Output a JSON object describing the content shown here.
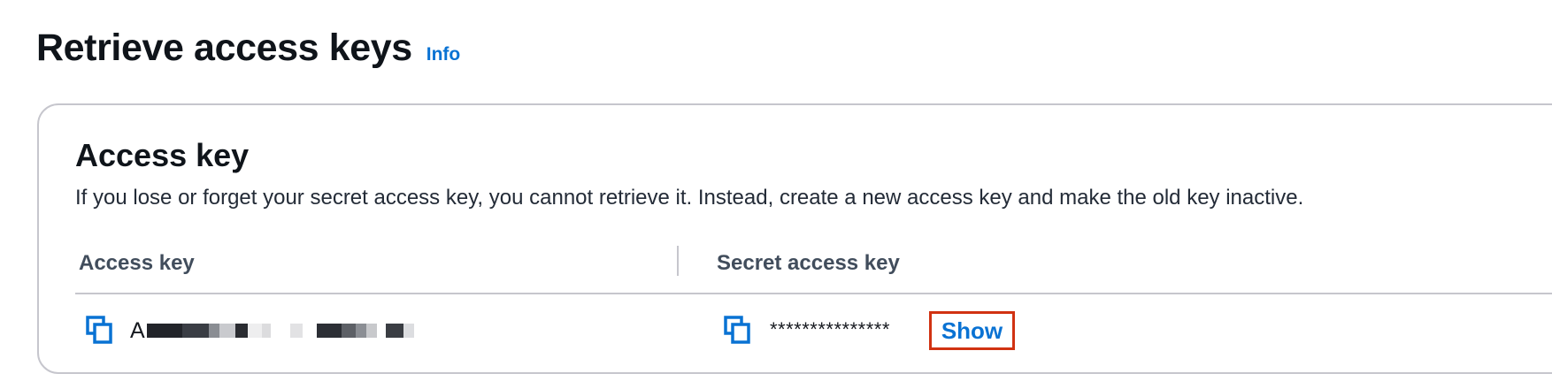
{
  "header": {
    "title": "Retrieve access keys",
    "info_link": "Info"
  },
  "panel": {
    "title": "Access key",
    "description": "If you lose or forget your secret access key, you cannot retrieve it. Instead, create a new access key and make the old key inactive.",
    "columns": {
      "access_key": "Access key",
      "secret_access_key": "Secret access key"
    },
    "row": {
      "access_key_prefix": "A",
      "secret_masked": "***************",
      "show_label": "Show"
    }
  },
  "icons": {
    "copy": "copy-icon"
  },
  "colors": {
    "link": "#0972d3",
    "highlight": "#d13212",
    "border": "#c6c6cd"
  }
}
